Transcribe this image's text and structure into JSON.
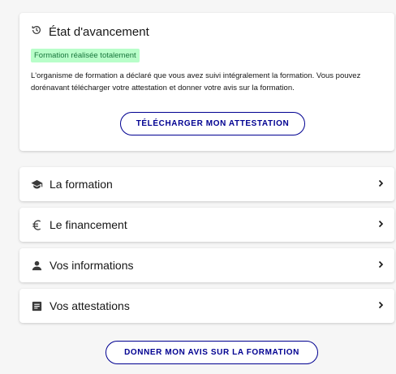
{
  "status": {
    "title": "État d'avancement",
    "icon": "history-icon",
    "badge": "Formation réalisée totalement",
    "badge_color": "#b8fec9",
    "description": "L'organisme de formation a déclaré que vous avez suivi intégralement la formation. Vous pouvez dorénavant télécharger votre attestation et donner votre avis sur la formation.",
    "download_label": "TÉLÉCHARGER MON ATTESTATION"
  },
  "sections": [
    {
      "label": "La formation",
      "icon": "graduation-cap-icon"
    },
    {
      "label": "Le financement",
      "icon": "euro-icon"
    },
    {
      "label": "Vos informations",
      "icon": "user-icon"
    },
    {
      "label": "Vos attestations",
      "icon": "document-icon"
    }
  ],
  "feedback_label": "DONNER MON AVIS SUR LA FORMATION",
  "accent_color": "#000091"
}
